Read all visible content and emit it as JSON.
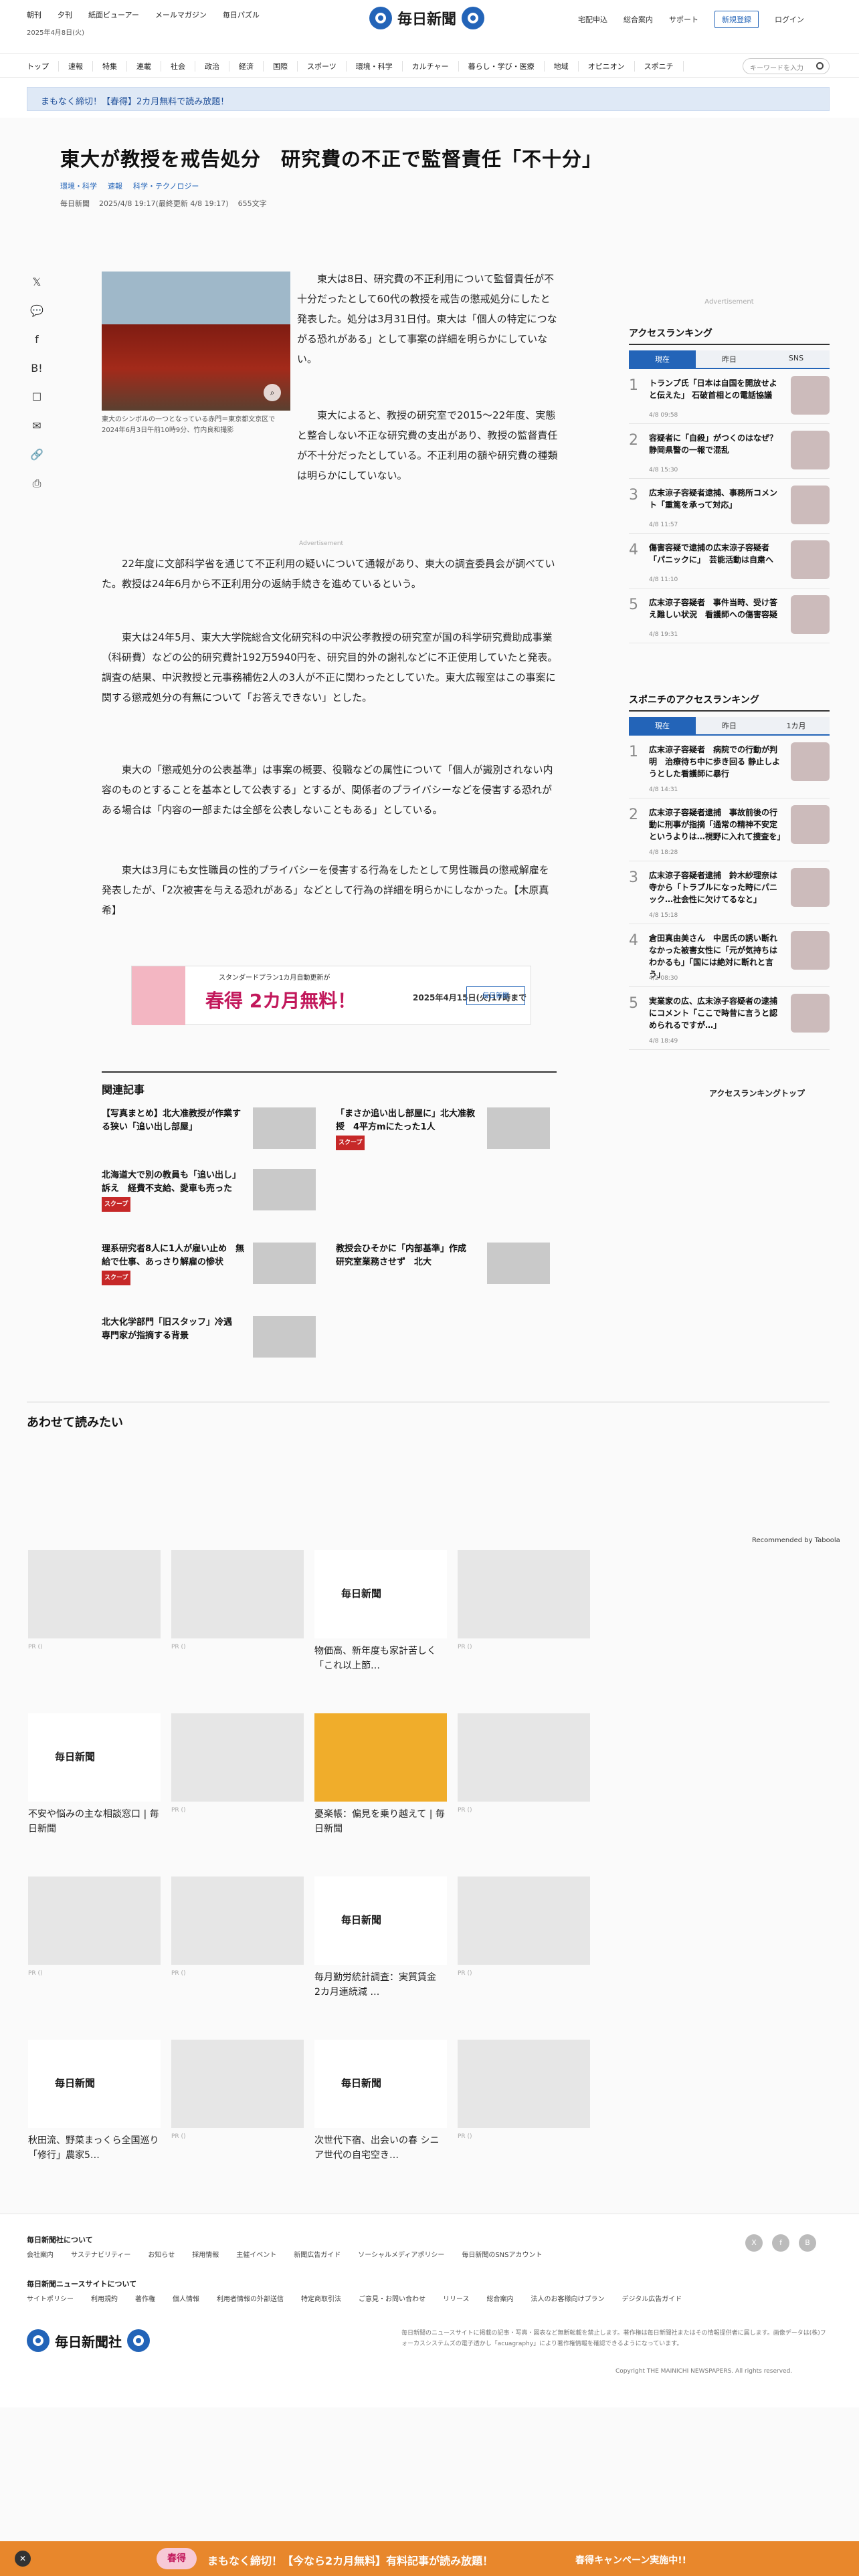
{
  "header": {
    "links_left": [
      "朝刊",
      "夕刊",
      "紙面ビューアー",
      "メールマガジン",
      "毎日パズル"
    ],
    "date": "2025年4月8日(火)",
    "logo_text": "毎日新聞",
    "links_right": [
      "宅配申込",
      "総合案内",
      "サポート"
    ],
    "register": "新規登録",
    "login": "ログイン"
  },
  "nav": {
    "items": [
      "トップ",
      "速報",
      "特集",
      "連載",
      "社会",
      "政治",
      "経済",
      "国際",
      "スポーツ",
      "環境・科学",
      "カルチャー",
      "暮らし・学び・医療",
      "地域",
      "オピニオン",
      "スポニチ"
    ],
    "search_placeholder": "キーワードを入力"
  },
  "banner": "まもなく締切！【春得】2カ月無料で読み放題！",
  "article": {
    "title": "東大が教授を戒告処分　研究費の不正で監督責任「不十分」",
    "categories": [
      "環境・科学",
      "速報",
      "科学・テクノロジー"
    ],
    "source": "毎日新聞",
    "updated": "2025/4/8 19:17(最終更新 4/8 19:17)",
    "chars": "655文字",
    "photo_caption": "東大のシンボルの一つとなっている赤門＝東京都文京区で2024年6月3日午前10時9分、竹内良和撮影",
    "paragraphs": [
      "東大は8日、研究費の不正利用について監督責任が不十分だったとして60代の教授を戒告の懲戒処分にしたと発表した。処分は3月31日付。東大は「個人の特定につながる恐れがある」として事案の詳細を明らかにしていない。",
      "東大によると、教授の研究室で2015～22年度、実態と整合しない不正な研究費の支出があり、教授の監督責任が不十分だったとしている。不正利用の額や研究費の種類は明らかにしていない。",
      "22年度に文部科学省を通じて不正利用の疑いについて通報があり、東大の調査委員会が調べていた。教授は24年6月から不正利用分の返納手続きを進めているという。",
      "東大は24年5月、東大大学院総合文化研究科の中沢公孝教授の研究室が国の科学研究費助成事業（科研費）などの公的研究費計192万5940円を、研究目的外の謝礼などに不正使用していたと発表。調査の結果、中沢教授と元事務補佐2人の3人が不正に関わったとしていた。東大広報室はこの事案に関する懲戒処分の有無について「お答えできない」とした。",
      "東大の「懲戒処分の公表基準」は事案の概要、役職などの属性について「個人が識別されない内容のものとすることを基本として公表する」とするが、関係者のプライバシーなどを侵害する恐れがある場合は「内容の一部または全部を公表しないこともある」としている。",
      "東大は3月にも女性職員の性的プライバシーを侵害する行為をしたとして男性職員の懲戒解雇を発表したが、「2次被害を与える恐れがある」などとして行為の詳細を明らかにしなかった。【木原真希】"
    ]
  },
  "ad_label": "Advertisement",
  "promo": {
    "small": "スタンダードプラン1カ月自動更新が",
    "big": "春得 2カ月無料！",
    "date": "2025年4月15日(火)17時まで",
    "logo": "毎日新聞"
  },
  "related": {
    "title": "関連記事",
    "items": [
      {
        "title": "【写真まとめ】北大准教授が作業する狭い「追い出し部屋」",
        "tag": ""
      },
      {
        "title": "「まさか追い出し部屋に」北大准教授　4平方mにたった1人",
        "tag": "スクープ"
      },
      {
        "title": "北海道大で別の教員も「追い出し」訴え　経費不支給、愛車も売った",
        "tag": "スクープ"
      },
      {
        "title": "理系研究者8人に1人が雇い止め　無給で仕事、あっさり解雇の惨状",
        "tag": "スクープ"
      },
      {
        "title": "教授会ひそかに「内部基準」作成　研究室業務させず　北大",
        "tag": ""
      },
      {
        "title": "北大化学部門「旧スタッフ」冷遇　専門家が指摘する背景",
        "tag": ""
      }
    ]
  },
  "ranking": {
    "title": "アクセスランキング",
    "tabs": [
      "現在",
      "昨日",
      "SNS"
    ],
    "items": [
      {
        "no": "1",
        "title": "トランプ氏「日本は自国を開放せよと伝えた」 石破首相との電話協議",
        "time": "4/8 09:58"
      },
      {
        "no": "2",
        "title": "容疑者に「自殺」がつくのはなぜ？　静岡県警の一報で混乱",
        "time": "4/8 15:30"
      },
      {
        "no": "3",
        "title": "広末涼子容疑者逮捕、事務所コメント「重篤を承って対応」",
        "time": "4/8 11:57"
      },
      {
        "no": "4",
        "title": "傷害容疑で逮捕の広末涼子容疑者「パニックに」　芸能活動は自粛へ",
        "time": "4/8 11:10"
      },
      {
        "no": "5",
        "title": "広末涼子容疑者　事件当時、受け答え難しい状況　看護師への傷害容疑",
        "time": "4/8 19:31"
      }
    ]
  },
  "sponichi": {
    "title": "スポニチのアクセスランキング",
    "tabs": [
      "現在",
      "昨日",
      "1カ月"
    ],
    "items": [
      {
        "no": "1",
        "title": "広末涼子容疑者　病院での行動が判明　治療待ち中に歩き回る 静止しようとした看護師に暴行",
        "time": "4/8 14:31"
      },
      {
        "no": "2",
        "title": "広末涼子容疑者逮捕　事故前後の行動に刑事が指摘「通常の精神不安定というよりは…視野に入れて捜査を」",
        "time": "4/8 18:28"
      },
      {
        "no": "3",
        "title": "広末涼子容疑者逮捕　鈴木紗理奈は寺から「トラブルになった時にパニック…社会性に欠けてるなと」",
        "time": "4/8 15:18"
      },
      {
        "no": "4",
        "title": "倉田真由美さん　中居氏の誘い断れなかった被害女性に「元が気持ちはわかるも」「国には絶対に断れと言う」",
        "time": "4/2 08:30"
      },
      {
        "no": "5",
        "title": "実業家の広、広末涼子容疑者の逮捕にコメント「ここで時昔に言うと認められるですが…」",
        "time": "4/8 18:49"
      }
    ],
    "more": "アクセスランキングトップ"
  },
  "awase": {
    "title": "あわせて読みたい",
    "recommended": "Recommended by Taboola",
    "cards": [
      {
        "title": "",
        "pr": "PR ()"
      },
      {
        "title": "",
        "pr": "PR ()"
      },
      {
        "title": "物価高、新年度も家計苦しく 「これ以上節…",
        "pr": ""
      },
      {
        "title": "",
        "pr": "PR ()"
      },
      {
        "title": "不安や悩みの主な相談窓口 | 毎日新聞",
        "pr": ""
      },
      {
        "title": "",
        "pr": "PR ()"
      },
      {
        "title": "憂楽帳：偏見を乗り越えて | 毎日新聞",
        "pr": ""
      },
      {
        "title": "",
        "pr": "PR ()"
      },
      {
        "title": "",
        "pr": "PR ()"
      },
      {
        "title": "",
        "pr": "PR ()"
      },
      {
        "title": "毎月勤労統計調査：実質賃金　2カ月連続減 …",
        "pr": ""
      },
      {
        "title": "",
        "pr": "PR ()"
      },
      {
        "title": "秋田流、野菜まっくら全国巡り「修行」農家5…",
        "pr": ""
      },
      {
        "title": "",
        "pr": "PR ()"
      },
      {
        "title": "次世代下宿、出会いの春 シニア世代の自宅空き…",
        "pr": ""
      },
      {
        "title": "",
        "pr": "PR ()"
      }
    ]
  },
  "footer": {
    "h1": "毎日新聞社について",
    "links1": [
      "会社案内",
      "サステナビリティー",
      "お知らせ",
      "採用情報",
      "主催イベント",
      "新聞広告ガイド",
      "ソーシャルメディアポリシー",
      "毎日新聞のSNSアカウント"
    ],
    "h2": "毎日新聞ニュースサイトについて",
    "links2": [
      "サイトポリシー",
      "利用規約",
      "著作権",
      "個人情報",
      "利用者情報の外部送信",
      "特定商取引法",
      "ご意見・お問い合わせ",
      "リリース",
      "総合案内",
      "法人のお客様向けプラン",
      "デジタル広告ガイド"
    ],
    "company": "毎日新聞社",
    "note": "毎日新聞のニュースサイトに掲載の記事・写真・図表など無断転載を禁止します。著作権は毎日新聞社またはその情報提供者に属します。画像データは(株)フォーカスシステムズの電子透かし「acuagraphy」により著作権情報を確認できるようになっています。",
    "copyright": "Copyright THE MAINICHI NEWSPAPERS. All rights reserved."
  },
  "bottom": {
    "pill": "春得",
    "text": "まもなく締切！【今なら2カ月無料】有料記事が読み放題！",
    "cta": "春得キャンペーン実施中!!"
  }
}
